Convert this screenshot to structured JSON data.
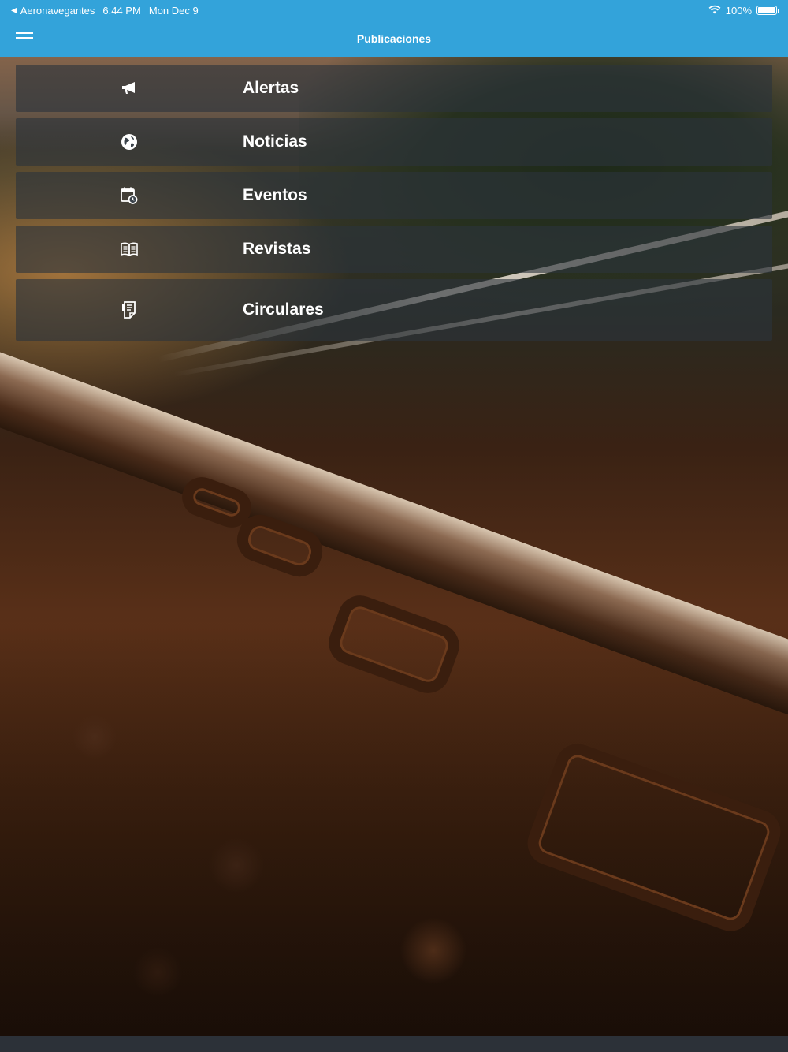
{
  "status_bar": {
    "back_app": "Aeronavegantes",
    "time": "6:44 PM",
    "date": "Mon Dec 9",
    "battery": "100%"
  },
  "nav": {
    "title": "Publicaciones",
    "menu_icon": "hamburger-icon"
  },
  "menu": {
    "items": [
      {
        "label": "Alertas",
        "icon": "megaphone-icon"
      },
      {
        "label": "Noticias",
        "icon": "globe-icon"
      },
      {
        "label": "Eventos",
        "icon": "calendar-clock-icon"
      },
      {
        "label": "Revistas",
        "icon": "open-book-icon"
      },
      {
        "label": "Circulares",
        "icon": "document-icon"
      }
    ]
  },
  "colors": {
    "header": "#33a3da",
    "menu_item_bg": "#2c343c",
    "text": "#ffffff"
  }
}
